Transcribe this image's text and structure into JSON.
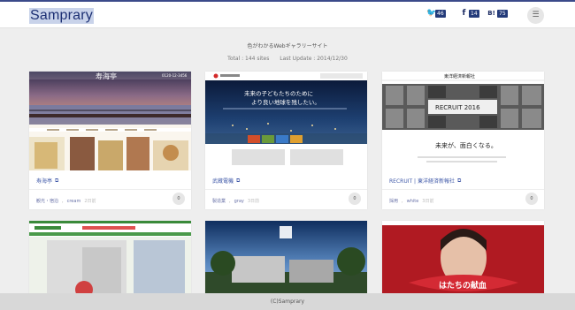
{
  "brand": {
    "logo": "Samprary",
    "accent": "#243b7a"
  },
  "header": {
    "social": [
      {
        "icon": "twitter-icon",
        "glyph": "🐦",
        "count": "46"
      },
      {
        "icon": "facebook-icon",
        "glyph": "f",
        "count": "14"
      },
      {
        "icon": "hatena-bookmark-icon",
        "glyph": "B!",
        "count": "75"
      }
    ],
    "menu_icon": "hamburger-menu-icon"
  },
  "site": {
    "title": "色がわかるWebギャラリーサイト",
    "total": "Total : 144 sites",
    "last_update": "Last Update : 2014/12/30"
  },
  "cards": [
    {
      "name": "寿海亭",
      "tags": [
        "観光・宿泊",
        "cream"
      ],
      "date": "2日前",
      "likes": "0"
    },
    {
      "name": "武蔵電機",
      "tags": [
        "製造業",
        "gray"
      ],
      "date": "3日前",
      "likes": "0"
    },
    {
      "name": "RECRUIT | 東洋経済新報社",
      "tags": [
        "採用",
        "white"
      ],
      "date": "3日前",
      "likes": "0"
    }
  ],
  "thumb_text": {
    "c1_logo": "寿海亭",
    "c1_tel": "0120-12-3456",
    "c2_headline": "未来の子どもたちのために",
    "c2_sub": "より良い地球を残したい。",
    "c3_header": "東洋経済新報社",
    "c3_recruit": "RECRUIT 2016",
    "c3_tagline": "未来が、面白くなる。",
    "c6_text": "はたちの献血"
  },
  "footer": {
    "copyright": "(C)Samprary"
  }
}
